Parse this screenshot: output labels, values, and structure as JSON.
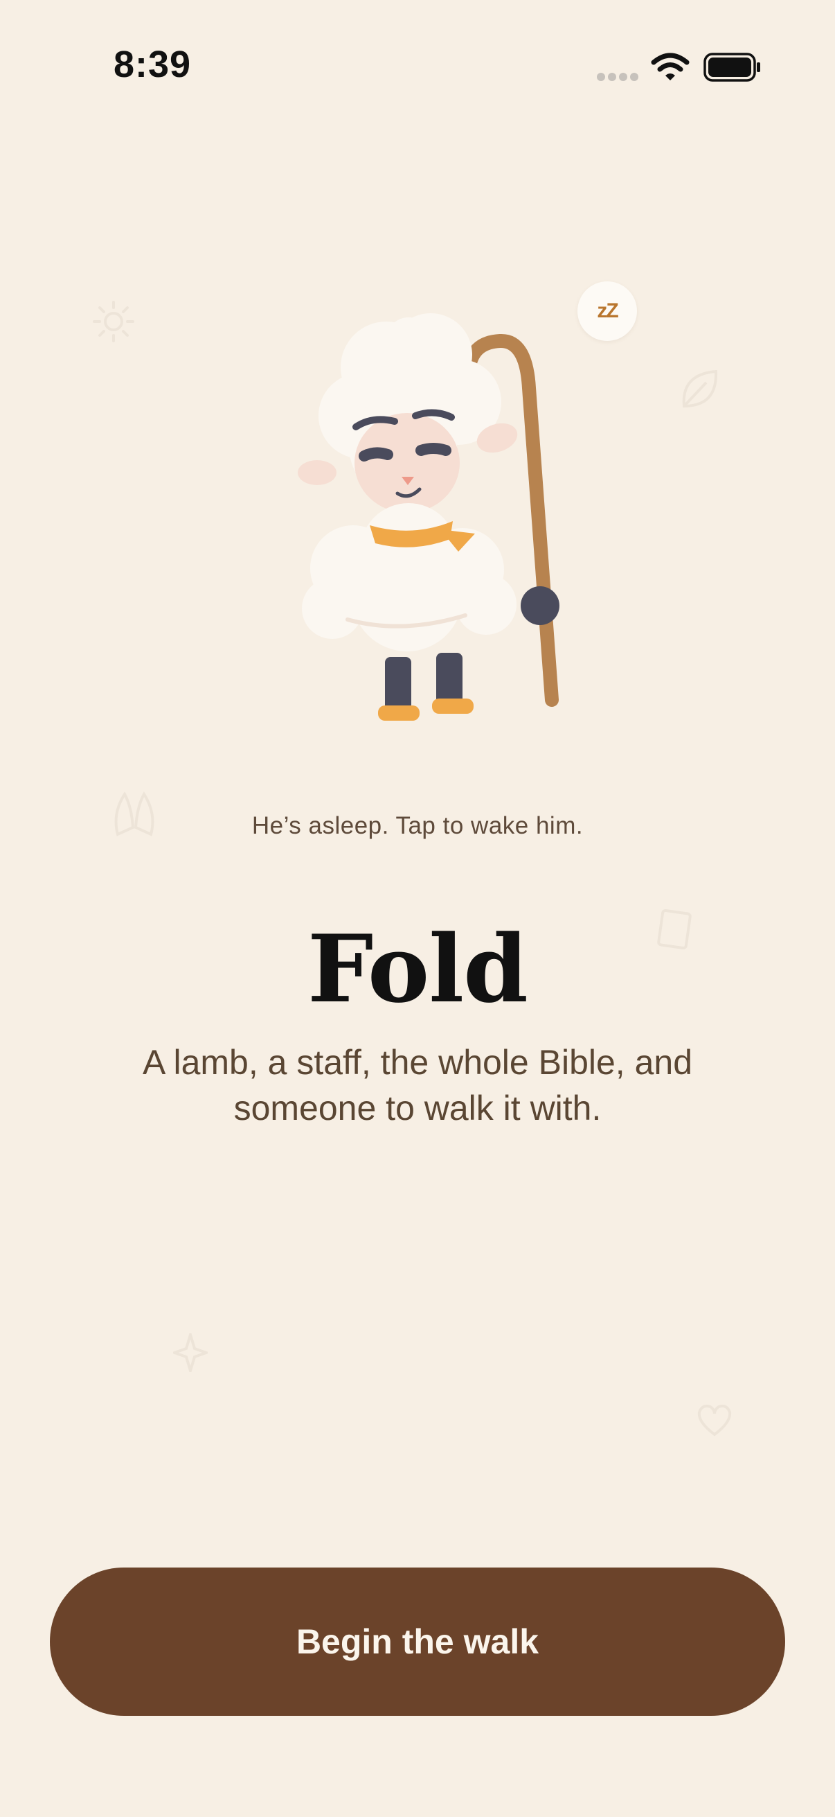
{
  "status_bar": {
    "time": "8:39",
    "icons": [
      "cellular-signal-icon",
      "wifi-icon",
      "battery-icon"
    ]
  },
  "mascot": {
    "icon": "sleeping-lamb-with-staff",
    "sleep_badge": "zZ"
  },
  "hint": "He’s asleep. Tap to wake him.",
  "title": "Fold",
  "subtitle": "A lamb, a staff, the whole Bible, and someone to walk it with.",
  "cta": {
    "label": "Begin the walk"
  },
  "colors": {
    "background": "#F7EFE4",
    "primary_button": "#6B432A",
    "button_text": "#FBF5EC",
    "body_text": "#5A4633",
    "title_text": "#111111",
    "accent_scarf": "#F0A848",
    "staff": "#B7834F",
    "sleep_badge_text": "#B9762E"
  }
}
